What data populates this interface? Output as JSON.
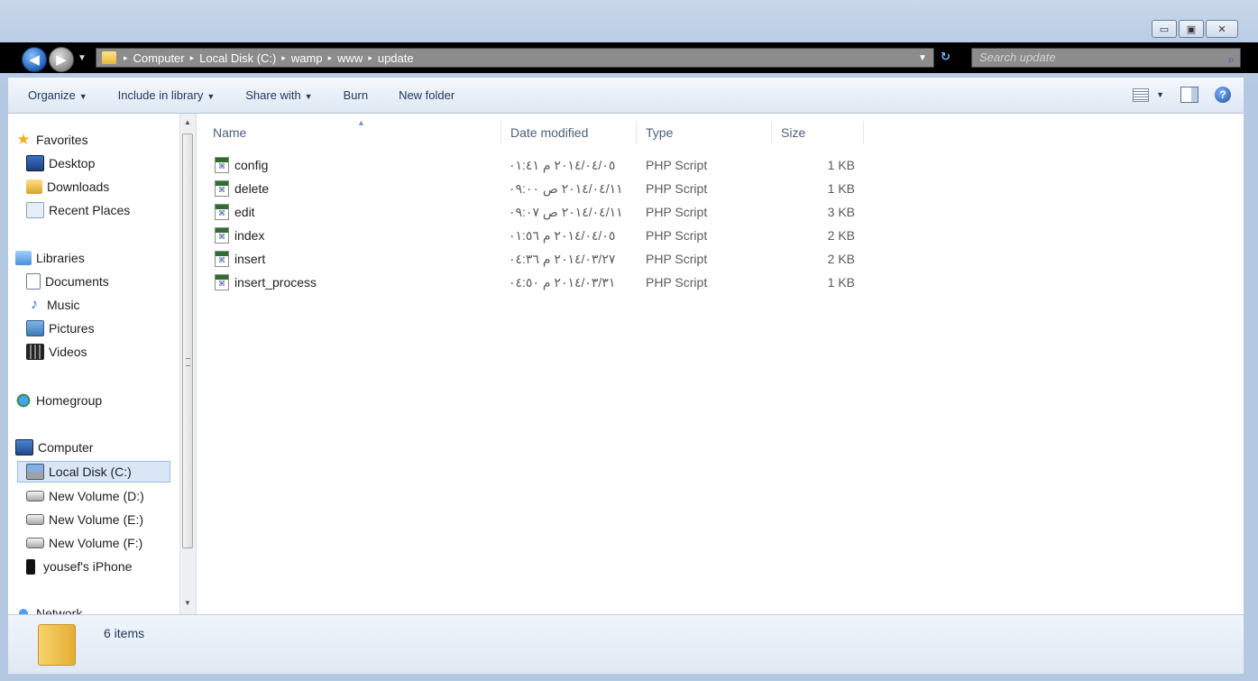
{
  "window": {
    "caption_buttons": [
      "▭",
      "▣",
      "✕"
    ]
  },
  "address_bar": {
    "back_glyph": "◀",
    "forward_glyph": "▶",
    "breadcrumbs": [
      "Computer",
      "Local Disk (C:)",
      "wamp",
      "www",
      "update"
    ],
    "separator": "▸",
    "refresh_glyph": "↻",
    "search_placeholder": "Search update",
    "search_glyph": "⌕"
  },
  "toolbar": {
    "organize": "Organize",
    "include_in_library": "Include in library",
    "share_with": "Share with",
    "burn": "Burn",
    "new_folder": "New folder",
    "caret": "▼",
    "help_glyph": "?"
  },
  "nav_pane": {
    "favorites": "Favorites",
    "desktop": "Desktop",
    "downloads": "Downloads",
    "recent_places": "Recent Places",
    "libraries": "Libraries",
    "documents": "Documents",
    "music": "Music",
    "pictures": "Pictures",
    "videos": "Videos",
    "homegroup": "Homegroup",
    "computer": "Computer",
    "local_disk": "Local Disk (C:)",
    "volume_d": "New Volume (D:)",
    "volume_e": "New Volume (E:)",
    "volume_f": "New Volume (F:)",
    "iphone": "yousef's iPhone",
    "network": "Network",
    "music_glyph": "♪",
    "star_glyph": "★",
    "scroll_up": "▲",
    "scroll_down": "▼"
  },
  "columns": {
    "name": "Name",
    "date_modified": "Date modified",
    "type": "Type",
    "size": "Size",
    "sort_glyph": "▲"
  },
  "files": [
    {
      "name": "config",
      "date": "٢٠١٤/٠٤/٠٥ م ٠١:٤١",
      "type": "PHP Script",
      "size": "1 KB"
    },
    {
      "name": "delete",
      "date": "٢٠١٤/٠٤/١١ ص ٠٩:٠٠",
      "type": "PHP Script",
      "size": "1 KB"
    },
    {
      "name": "edit",
      "date": "٢٠١٤/٠٤/١١ ص ٠٩:٠٧",
      "type": "PHP Script",
      "size": "3 KB"
    },
    {
      "name": "index",
      "date": "٢٠١٤/٠٤/٠٥ م ٠١:٥٦",
      "type": "PHP Script",
      "size": "2 KB"
    },
    {
      "name": "insert",
      "date": "٢٠١٤/٠٣/٢٧ م ٠٤:٣٦",
      "type": "PHP Script",
      "size": "2 KB"
    },
    {
      "name": "insert_process",
      "date": "٢٠١٤/٠٣/٣١ م ٠٤:٥٠",
      "type": "PHP Script",
      "size": "1 KB"
    }
  ],
  "status": {
    "item_count": "6 items"
  }
}
